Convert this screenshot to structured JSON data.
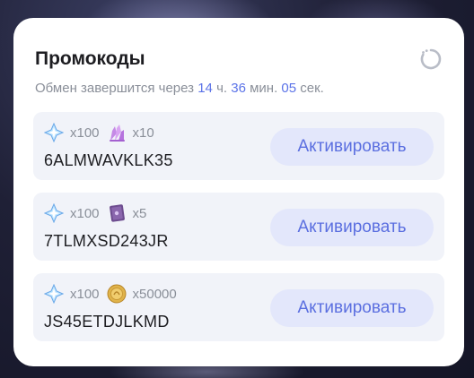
{
  "panel": {
    "title": "Промокоды",
    "subtitle": {
      "prefix": "Обмен завершится через",
      "hours": "14",
      "hours_unit": "ч.",
      "minutes": "36",
      "minutes_unit": "мин.",
      "seconds": "05",
      "seconds_unit": "сек."
    },
    "accent_color": "#5b73e8"
  },
  "codes": [
    {
      "code": "6ALMWAVKLK35",
      "rewards": [
        {
          "icon": "primogem-icon",
          "count": "x100"
        },
        {
          "icon": "crystal-icon",
          "count": "x10"
        }
      ],
      "button_label": "Активировать"
    },
    {
      "code": "7TLMXSD243JR",
      "rewards": [
        {
          "icon": "primogem-icon",
          "count": "x100"
        },
        {
          "icon": "book-icon",
          "count": "x5"
        }
      ],
      "button_label": "Активировать"
    },
    {
      "code": "JS45ETDJLKMD",
      "rewards": [
        {
          "icon": "primogem-icon",
          "count": "x100"
        },
        {
          "icon": "coin-icon",
          "count": "x50000"
        }
      ],
      "button_label": "Активировать"
    }
  ]
}
